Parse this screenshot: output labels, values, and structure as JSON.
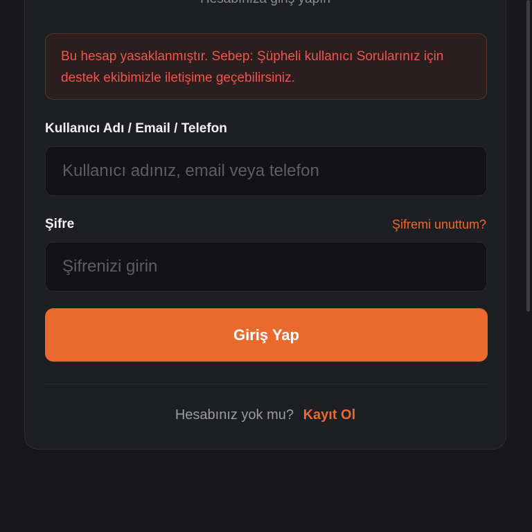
{
  "login": {
    "subtitle": "Hesabınıza giriş yapın",
    "alert": {
      "message": "Bu hesap yasaklanmıştır. Sebep: Şüpheli kullanıcı Sorularınız için destek ekibimizle iletişime geçebilirsiniz."
    },
    "username": {
      "label": "Kullanıcı Adı / Email / Telefon",
      "placeholder": "Kullanıcı adınız, email veya telefon",
      "value": ""
    },
    "password": {
      "label": "Şifre",
      "forgot_label": "Şifremi unuttum?",
      "placeholder": "Şifrenizi girin",
      "value": ""
    },
    "submit_label": "Giriş Yap",
    "signup": {
      "prompt": "Hesabınız yok mu?",
      "link_label": "Kayıt Ol"
    }
  },
  "colors": {
    "background": "#18181a",
    "card": "#1e1f22",
    "accent": "#ea6a2e",
    "error_text": "#f0554d",
    "error_background": "#2b1e1e"
  }
}
